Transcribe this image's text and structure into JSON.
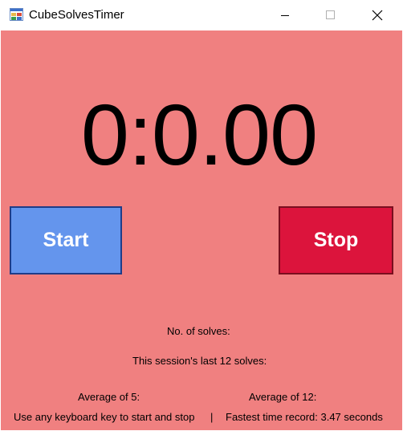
{
  "window": {
    "title": "CubeSolvesTimer",
    "icon": "winforms-app-icon",
    "controls": {
      "minimize_icon": "minimize-icon",
      "maximize_icon": "maximize-icon",
      "close_icon": "close-icon"
    }
  },
  "timer": {
    "display": "0:0.00"
  },
  "buttons": {
    "start_label": "Start",
    "stop_label": "Stop"
  },
  "stats": {
    "solves_label": "No. of solves:",
    "last12_label": "This session's last 12 solves:",
    "avg5_label": "Average of 5:",
    "avg12_label": "Average of 12:",
    "keyboard_hint": "Use any keyboard key to start and stop",
    "separator": "|",
    "fastest_label": "Fastest time record: 3.47 seconds"
  },
  "colors": {
    "background": "#f08080",
    "start_button": "#6495ed",
    "stop_button": "#dc143c",
    "text": "#000000",
    "button_text": "#ffffff"
  }
}
